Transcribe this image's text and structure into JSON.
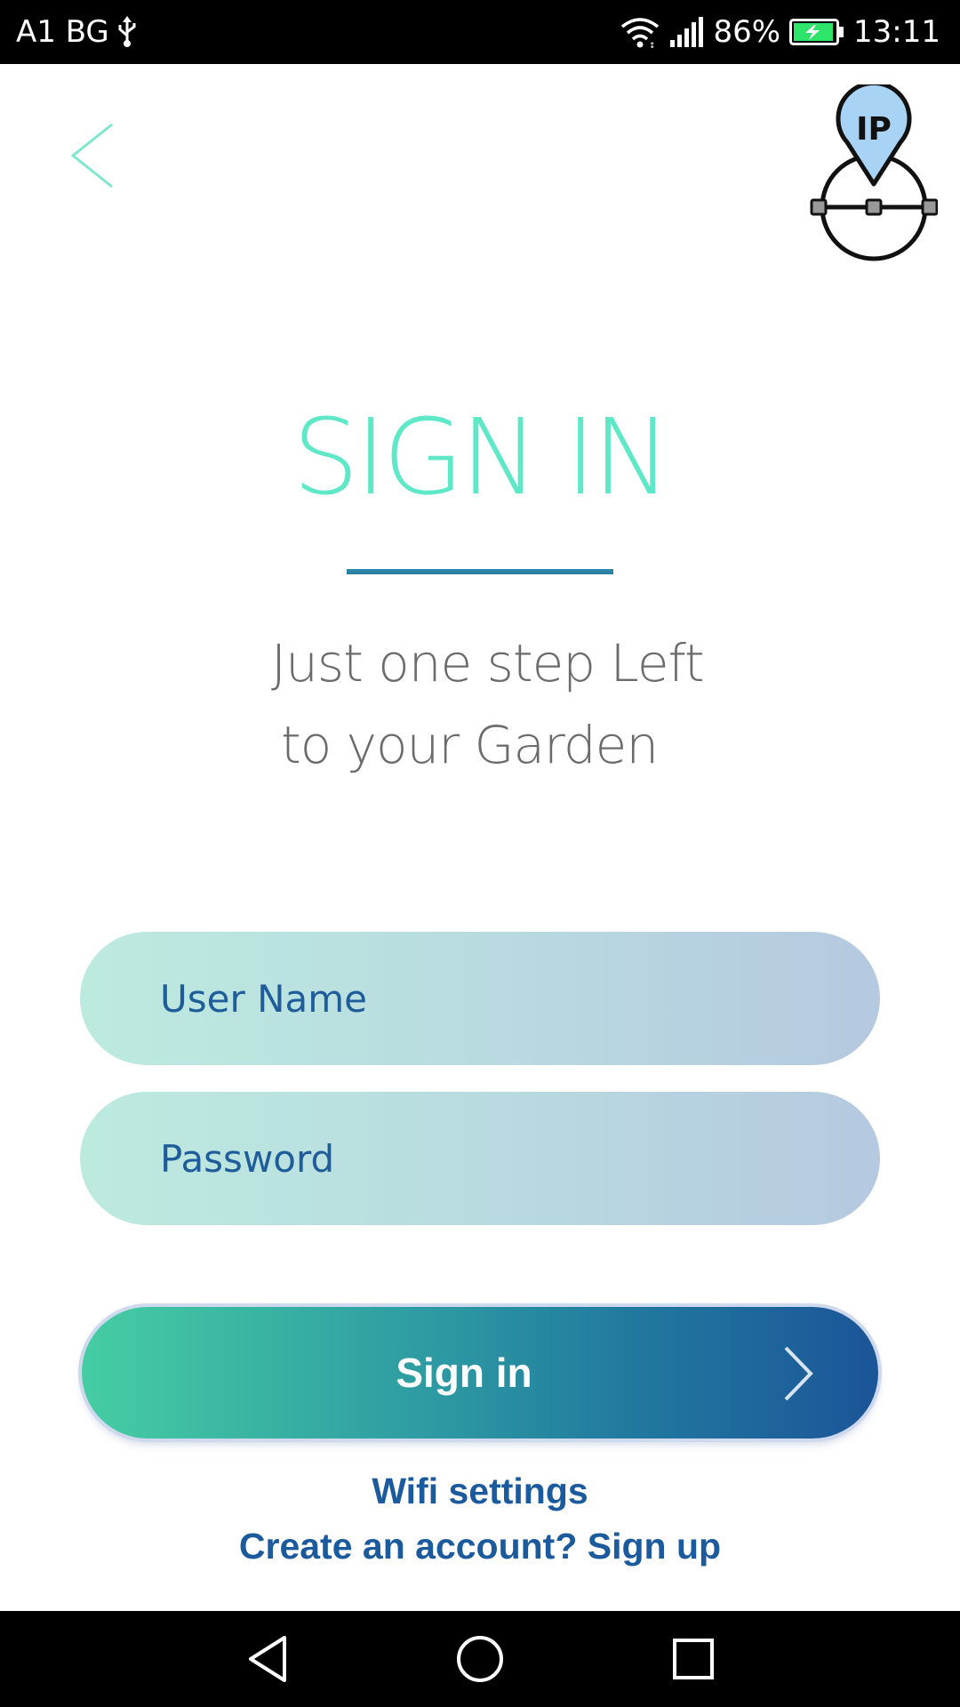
{
  "status_bar": {
    "carrier": "A1 BG",
    "usb_icon": "usb-icon",
    "wifi_icon": "wifi-icon",
    "signal_icon": "signal-icon",
    "battery_percent": "86%",
    "battery_icon": "battery-charging-icon",
    "time": "13:11"
  },
  "header": {
    "back_icon": "chevron-left-icon",
    "logo": {
      "icon": "ip-location-logo",
      "text": "IP"
    }
  },
  "main": {
    "title": "SIGN IN",
    "subtitle_line_1": "Just one step Left",
    "subtitle_line_2": "to your Garden"
  },
  "form": {
    "username_placeholder": "User Name",
    "password_placeholder": "Password",
    "signin_label": "Sign in",
    "signin_icon": "chevron-right-icon"
  },
  "links": {
    "wifi_settings": "Wifi settings",
    "signup": "Create an account? Sign up"
  },
  "nav_bar": {
    "back_icon": "nav-back-icon",
    "home_icon": "nav-home-icon",
    "recents_icon": "nav-recents-icon"
  },
  "colors": {
    "title": "#5ee8c8",
    "accent_blue": "#1c5a9e",
    "button_start": "#46cda3",
    "button_end": "#1b5598",
    "status_bar": "#000000"
  }
}
